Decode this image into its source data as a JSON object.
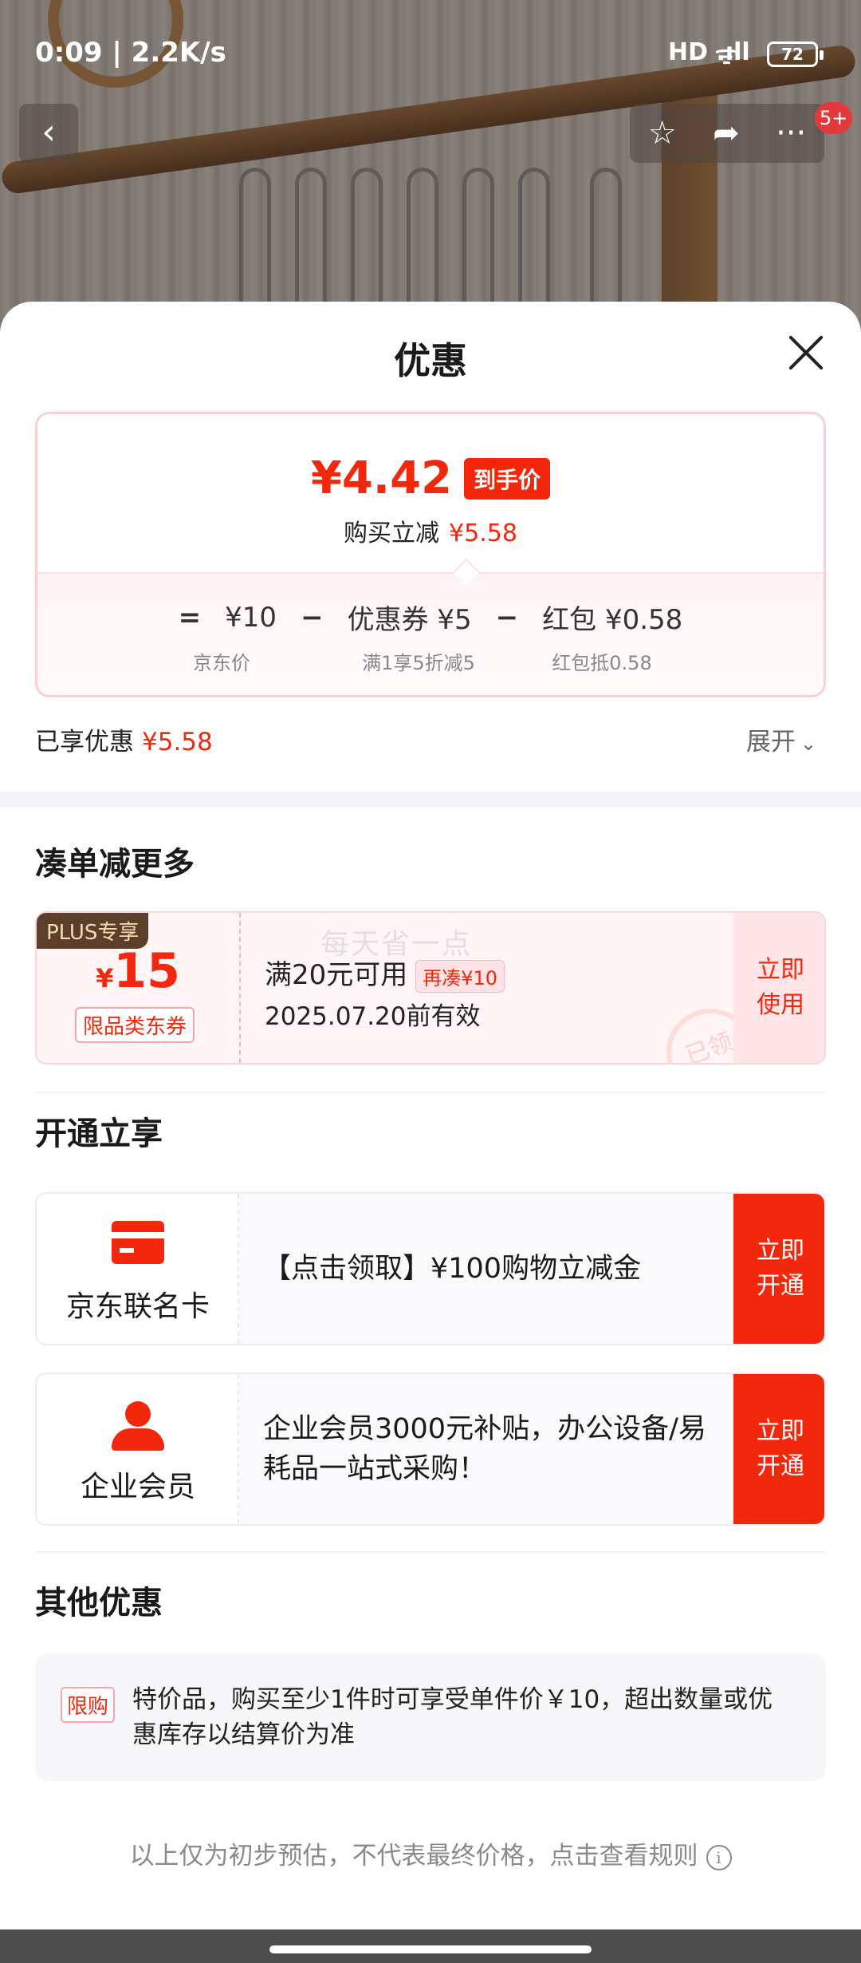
{
  "status_bar": {
    "time": "0:09 | 2.2K/s",
    "signal": "HD .ıll",
    "wifi": "ᯤ",
    "battery": "72"
  },
  "nav": {
    "back_icon": "‹",
    "favorite_icon": "☆",
    "share_icon": "➦",
    "more_icon": "···",
    "message_badge": "5+"
  },
  "sheet": {
    "title": "优惠",
    "summary": {
      "final_price": "¥4.42",
      "final_tag": "到手价",
      "saved_label": "购买立减",
      "saved_amount": "¥5.58",
      "formula": {
        "equals": "=",
        "jd_price": "¥10",
        "jd_price_label": "京东价",
        "minus1": "−",
        "coupon": "优惠券 ¥5",
        "coupon_label": "满1享5折减5",
        "minus2": "−",
        "redpacket": "红包 ¥0.58",
        "redpacket_label": "红包抵0.58"
      }
    },
    "enjoyed_label": "已享优惠",
    "enjoyed_amount": "¥5.58",
    "expand_label": "展开",
    "expand_icon": "⌄",
    "stack": {
      "title": "凑单减更多",
      "coupon": {
        "plus_tag": "PLUS专享",
        "yen": "¥",
        "amount": "15",
        "limit": "限品类东券",
        "condition": "满20元可用",
        "more_tag": "再凑¥10",
        "validity": "2025.07.20前有效",
        "watermark": "每天省一点",
        "stamp": "已领",
        "use_line1": "立即",
        "use_line2": "使用"
      }
    },
    "open": {
      "title": "开通立享",
      "cards": [
        {
          "name": "京东联名卡",
          "desc": "【点击领取】¥100购物立减金",
          "btn_line1": "立即",
          "btn_line2": "开通"
        },
        {
          "name": "企业会员",
          "desc": "企业会员3000元补贴，办公设备/易耗品一站式采购！",
          "btn_line1": "立即",
          "btn_line2": "开通"
        }
      ]
    },
    "other": {
      "title": "其他优惠",
      "tag": "限购",
      "text": "特价品，购买至少1件时可享受单件价￥10，超出数量或优惠库存以结算价为准"
    },
    "footnote": "以上仅为初步预估，不代表最终价格，点击查看规则",
    "footnote_icon": "i"
  },
  "colors": {
    "accent": "#f2270c",
    "plus_bg": "#5b3f2a",
    "pink_border": "#fbd0d4"
  }
}
